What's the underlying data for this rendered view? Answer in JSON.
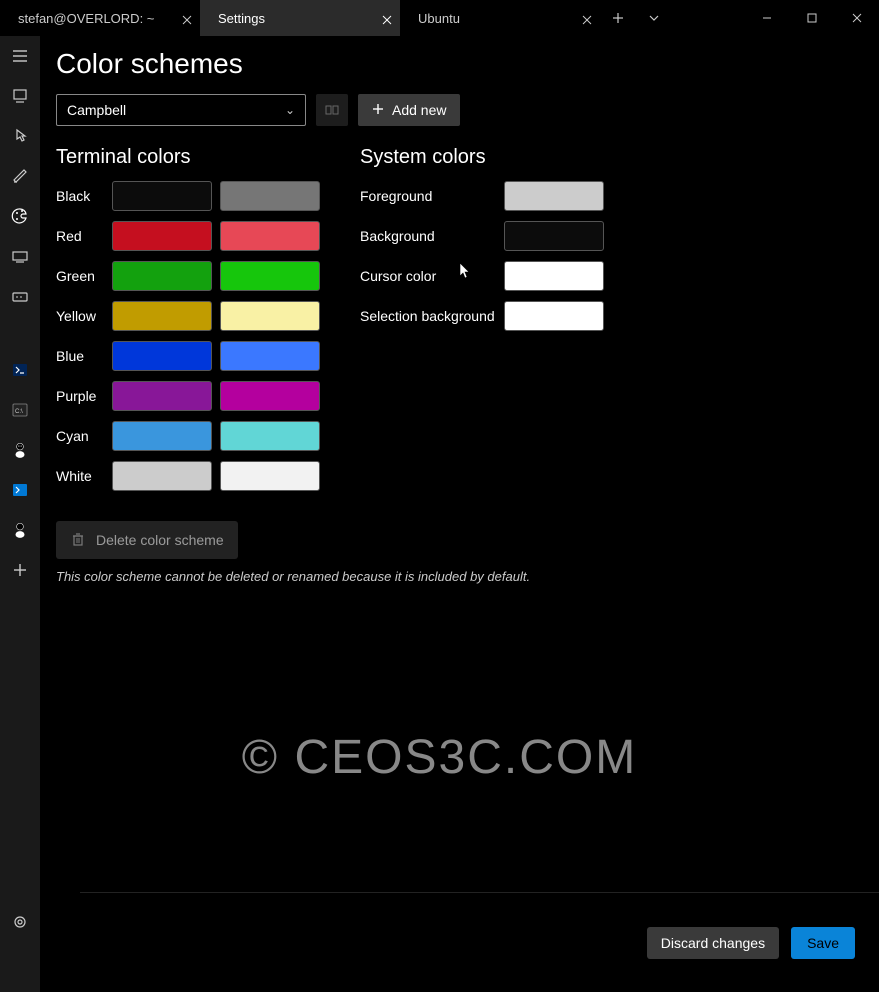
{
  "tabs": [
    {
      "label": "stefan@OVERLORD: ~",
      "icon": "tux"
    },
    {
      "label": "Settings",
      "icon": "gear"
    },
    {
      "label": "Ubuntu",
      "icon": "tux"
    }
  ],
  "page": {
    "title": "Color schemes",
    "scheme_selected": "Campbell",
    "add_new_label": "Add new",
    "terminal_colors_heading": "Terminal colors",
    "system_colors_heading": "System colors",
    "delete_label": "Delete color scheme",
    "note": "This color scheme cannot be deleted or renamed because it is included by default."
  },
  "terminal_colors": [
    {
      "name": "Black",
      "normal": "#0c0c0c",
      "bright": "#767676"
    },
    {
      "name": "Red",
      "normal": "#c50f1f",
      "bright": "#e74856"
    },
    {
      "name": "Green",
      "normal": "#13a10e",
      "bright": "#16c60c"
    },
    {
      "name": "Yellow",
      "normal": "#c19c00",
      "bright": "#f9f1a5"
    },
    {
      "name": "Blue",
      "normal": "#0037da",
      "bright": "#3b78ff"
    },
    {
      "name": "Purple",
      "normal": "#881798",
      "bright": "#b4009e"
    },
    {
      "name": "Cyan",
      "normal": "#3a96dd",
      "bright": "#61d6d6"
    },
    {
      "name": "White",
      "normal": "#cccccc",
      "bright": "#f2f2f2"
    }
  ],
  "system_colors": [
    {
      "name": "Foreground",
      "value": "#cccccc"
    },
    {
      "name": "Background",
      "value": "#0c0c0c"
    },
    {
      "name": "Cursor color",
      "value": "#ffffff"
    },
    {
      "name": "Selection background",
      "value": "#ffffff"
    }
  ],
  "footer": {
    "discard_label": "Discard changes",
    "save_label": "Save"
  },
  "watermark": "© CEOS3C.COM"
}
